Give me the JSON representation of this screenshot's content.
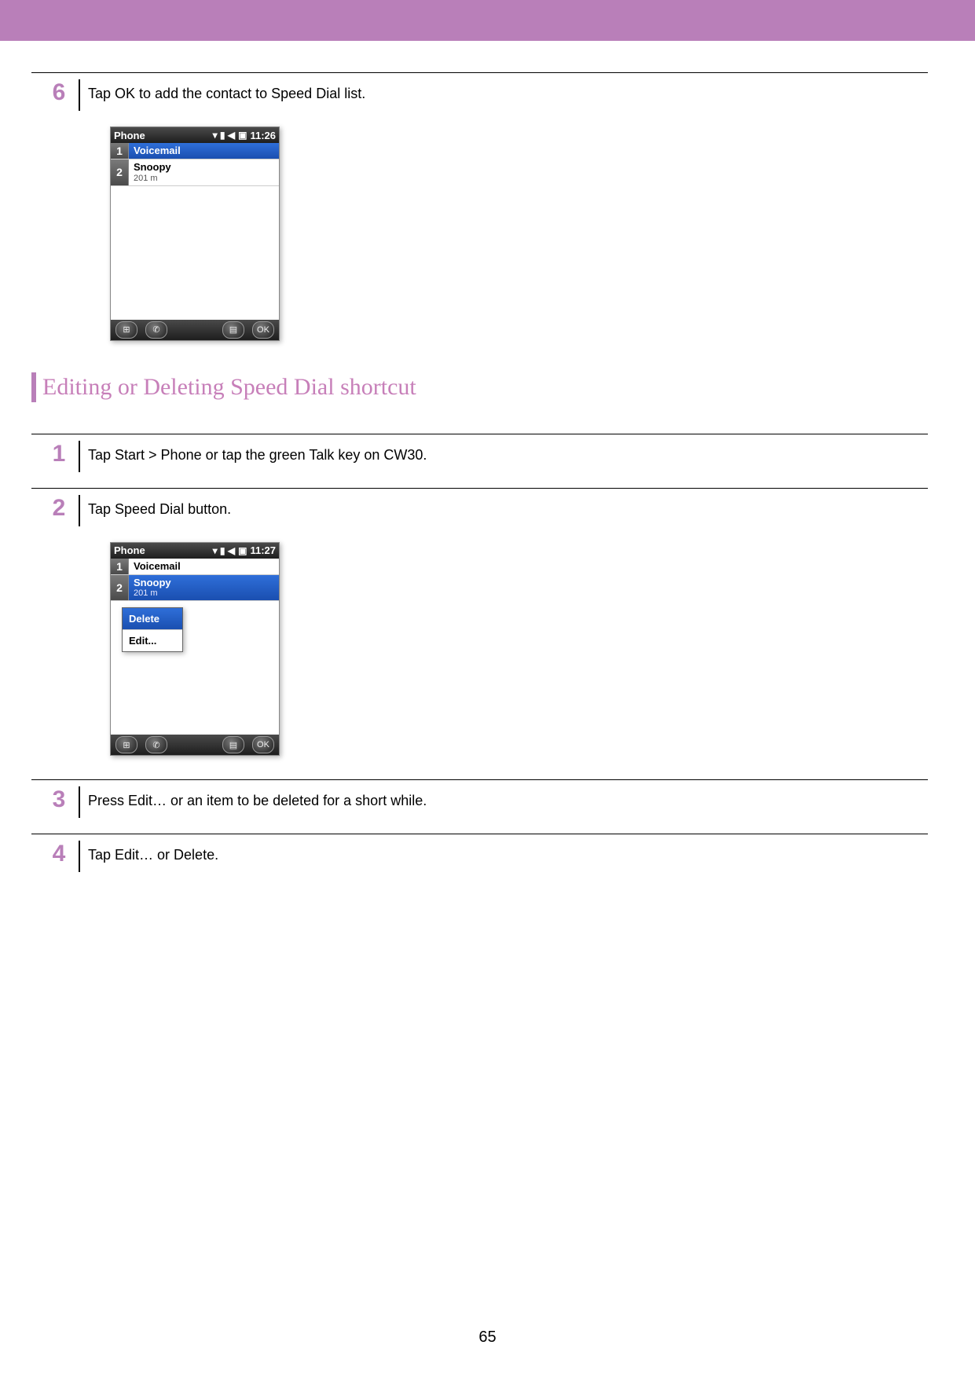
{
  "page_number": "65",
  "section_title": "Editing or Deleting Speed Dial shortcut",
  "step6": {
    "num": "6",
    "text": "Tap OK to add the contact to Speed Dial list."
  },
  "step1": {
    "num": "1",
    "text": "Tap Start > Phone or tap the green Talk key on CW30."
  },
  "step2": {
    "num": "2",
    "text": "Tap Speed Dial button."
  },
  "step3": {
    "num": "3",
    "text": "Press Edit… or an item to be deleted for a short while."
  },
  "step4": {
    "num": "4",
    "text": "Tap Edit… or Delete."
  },
  "phone1": {
    "title": "Phone",
    "signal": "▾ ▮ ◀",
    "time": "11:26",
    "rows": [
      {
        "num": "1",
        "name": "Voicemail",
        "sub": "",
        "sel": true
      },
      {
        "num": "2",
        "name": "Snoopy",
        "sub": "201 m",
        "sel": false
      }
    ],
    "task_left": [
      "⊞",
      "✆"
    ],
    "task_right": [
      "▤",
      "OK"
    ]
  },
  "phone2": {
    "title": "Phone",
    "signal": "▾ ▮ ◀",
    "time": "11:27",
    "rows": [
      {
        "num": "1",
        "name": "Voicemail",
        "sub": "",
        "sel": false
      },
      {
        "num": "2",
        "name": "Snoopy",
        "sub": "201 m",
        "sel": true
      }
    ],
    "menu": [
      {
        "label": "Delete",
        "sel": true
      },
      {
        "label": "Edit...",
        "sel": false
      }
    ],
    "task_left": [
      "⊞",
      "✆"
    ],
    "task_right": [
      "▤",
      "OK"
    ]
  }
}
